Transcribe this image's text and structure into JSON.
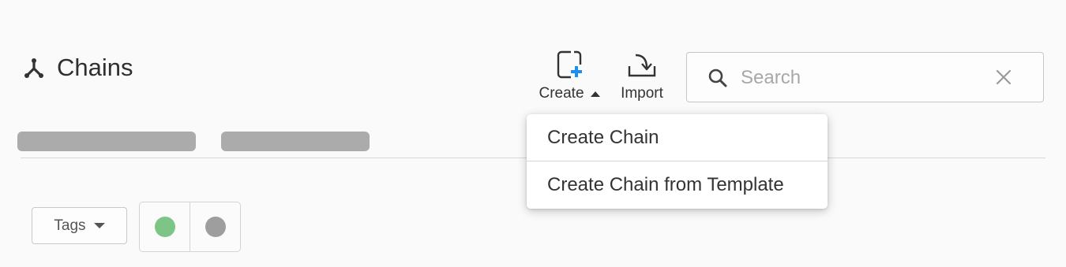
{
  "header": {
    "title": "Chains",
    "title_icon": "chains-icon"
  },
  "toolbar": {
    "create_label": "Create",
    "create_icon": "add-canvas-icon",
    "import_label": "Import",
    "import_icon": "import-icon",
    "accent_color": "#1a8ff0"
  },
  "search": {
    "placeholder": "Search",
    "value": ""
  },
  "create_menu": {
    "items": [
      {
        "label": "Create Chain"
      },
      {
        "label": "Create Chain from Template"
      }
    ]
  },
  "filters": {
    "tags_label": "Tags",
    "status_colors": [
      "#7dc584",
      "#9e9e9e"
    ]
  }
}
